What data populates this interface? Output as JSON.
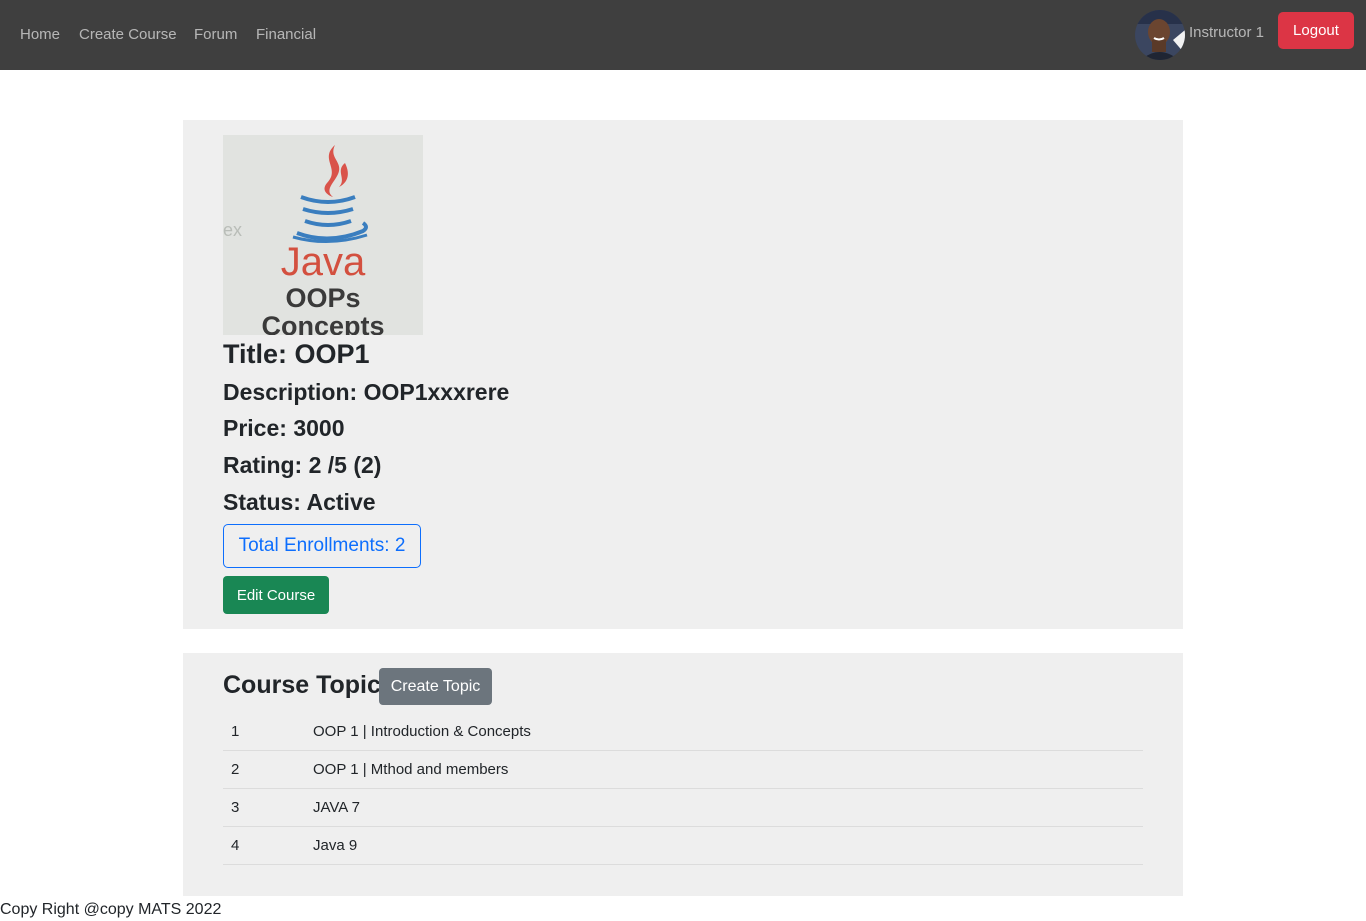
{
  "nav": {
    "links": [
      {
        "label": "Home"
      },
      {
        "label": "Create Course"
      },
      {
        "label": "Forum"
      },
      {
        "label": "Financial"
      }
    ],
    "user_name": "Instructor 1",
    "logout_label": "Logout"
  },
  "course": {
    "image": {
      "line1": "Java",
      "line2": "OOPs",
      "line3": "Concepts",
      "watermark": "ex"
    },
    "title": "Title: OOP1",
    "description": "Description: OOP1xxxrere",
    "price": "Price: 3000",
    "rating": "Rating: 2 /5 (2)",
    "status": "Status: Active",
    "enrollments_label": "Total Enrollments: 2",
    "edit_label": "Edit Course"
  },
  "topics": {
    "heading": "Course Topics",
    "create_label": "Create Topic",
    "rows": [
      {
        "num": "1",
        "name": "OOP 1 | Introduction & Concepts"
      },
      {
        "num": "2",
        "name": "OOP 1 | Mthod and members"
      },
      {
        "num": "3",
        "name": "JAVA 7"
      },
      {
        "num": "4",
        "name": "Java 9"
      }
    ]
  },
  "footer": "Copy Right @copy MATS 2022",
  "colors": {
    "navbar": "#3f3f3f",
    "logout": "#dc3545",
    "enroll_outline": "#0d6efd",
    "edit": "#198754",
    "create_topic": "#6c757d",
    "card_bg": "#efefef"
  }
}
